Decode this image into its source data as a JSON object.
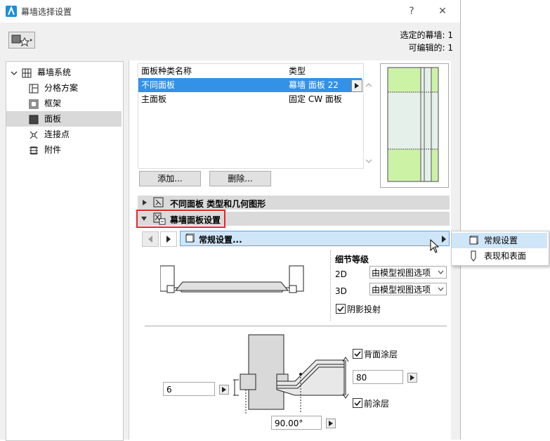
{
  "window": {
    "title": "幕墙选择设置",
    "help": "?",
    "close": "✕"
  },
  "info": {
    "selected_label": "选定的幕墙: 1",
    "editable_label": "可编辑的: 1"
  },
  "nav": {
    "items": [
      {
        "label": "幕墙系统"
      },
      {
        "label": "分格方案"
      },
      {
        "label": "框架"
      },
      {
        "label": "面板"
      },
      {
        "label": "连接点"
      },
      {
        "label": "附件"
      }
    ]
  },
  "panel_list": {
    "headers": [
      "面板种类名称",
      "类型"
    ],
    "rows": [
      {
        "name": "不同面板",
        "type": "幕墙 面板 22"
      },
      {
        "name": "主面板",
        "type": "固定 CW 面板"
      }
    ],
    "add_label": "添加...",
    "delete_label": "删除..."
  },
  "sections": {
    "type_geometry": "不同面板 类型和几何图形",
    "panel_settings": "幕墙面板设置"
  },
  "page_selector": {
    "current": "常规设置..."
  },
  "popup": {
    "items": [
      "常规设置",
      "表现和表面"
    ]
  },
  "detail": {
    "heading": "细节等级",
    "rows": [
      {
        "label": "2D",
        "value": "由模型视图选项"
      },
      {
        "label": "3D",
        "value": "由模型视图选项"
      }
    ],
    "shadow_label": "阴影投射"
  },
  "dims": {
    "left_value": "6",
    "right_value": "80",
    "angle_value": "90.00°",
    "back_coating_label": "背面涂层",
    "front_coating_label": "前涂层"
  },
  "colors": {
    "selection": "#3391e8",
    "highlight_box": "#e5262a",
    "panel_green": "#ccf2a6"
  }
}
